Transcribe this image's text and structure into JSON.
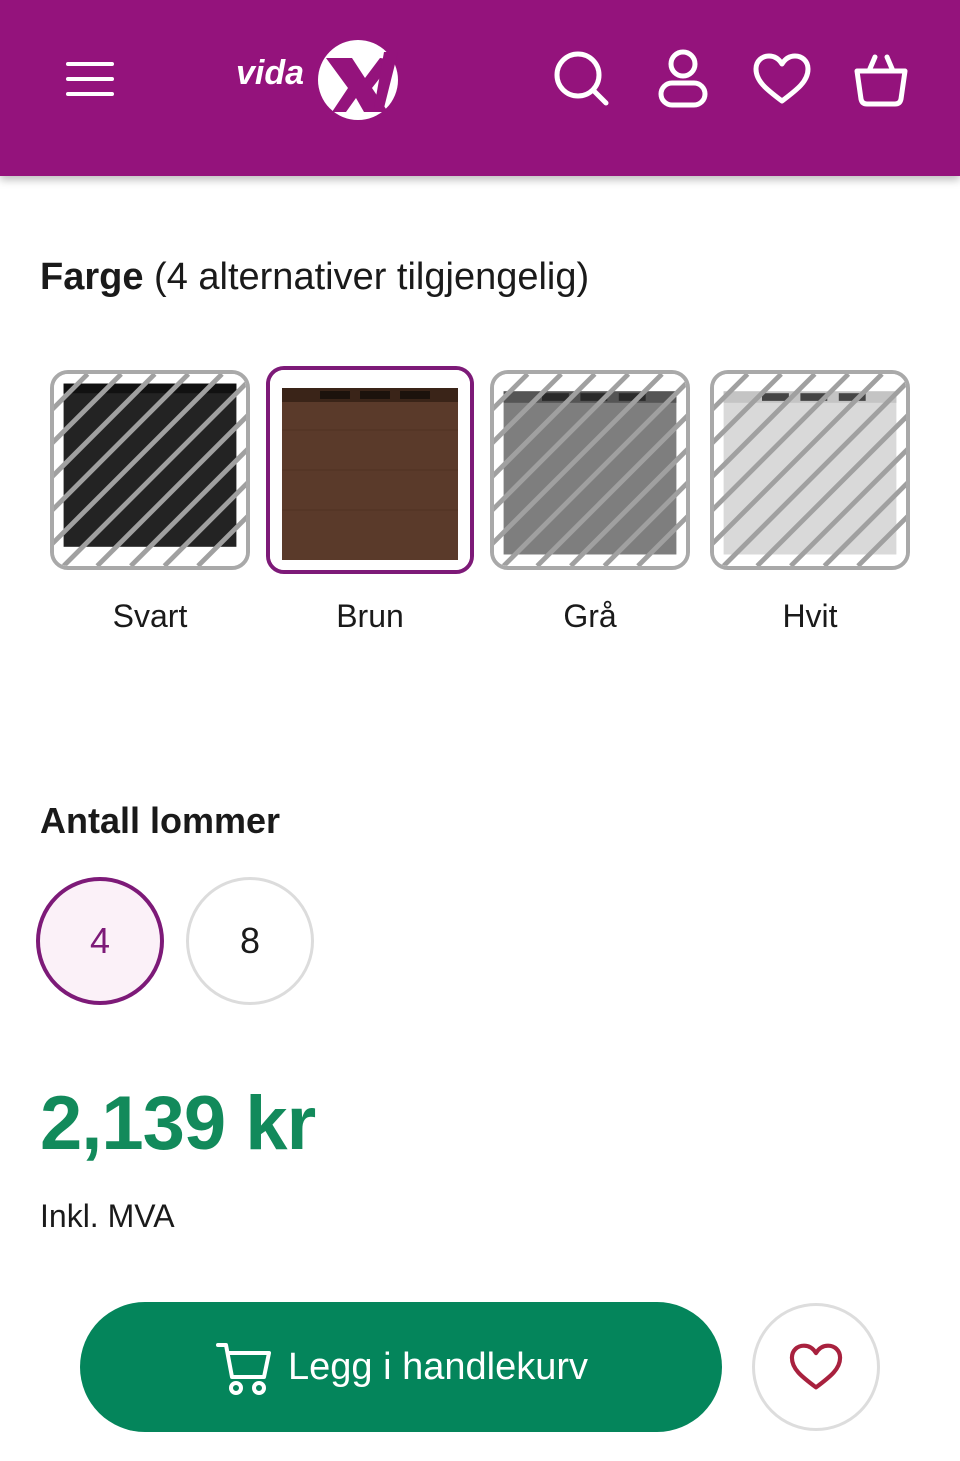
{
  "header": {
    "background": "#94137c",
    "logo_text": "vidaXL",
    "icons": [
      "menu-icon",
      "search-icon",
      "account-icon",
      "wishlist-icon",
      "cart-icon"
    ]
  },
  "color_selector": {
    "heading_bold": "Farge",
    "heading_rest": " (4 alternativer tilgjengelig)",
    "options": [
      {
        "label": "Svart",
        "color": "#232323",
        "selected": false,
        "available": false
      },
      {
        "label": "Brun",
        "color": "#5a3a2a",
        "selected": true,
        "available": true
      },
      {
        "label": "Grå",
        "color": "#7e7e7e",
        "selected": false,
        "available": false
      },
      {
        "label": "Hvit",
        "color": "#d9d9d9",
        "selected": false,
        "available": false
      }
    ]
  },
  "pockets": {
    "heading": "Antall lommer",
    "options": [
      {
        "label": "4",
        "selected": true
      },
      {
        "label": "8",
        "selected": false
      }
    ]
  },
  "price": {
    "amount": "2,139 kr",
    "vat_note": "Inkl. MVA",
    "color": "#128a5b"
  },
  "actions": {
    "add_to_cart_label": "Legg i handlekurv",
    "button_color": "#04855b",
    "accent": "#7d1a78"
  }
}
